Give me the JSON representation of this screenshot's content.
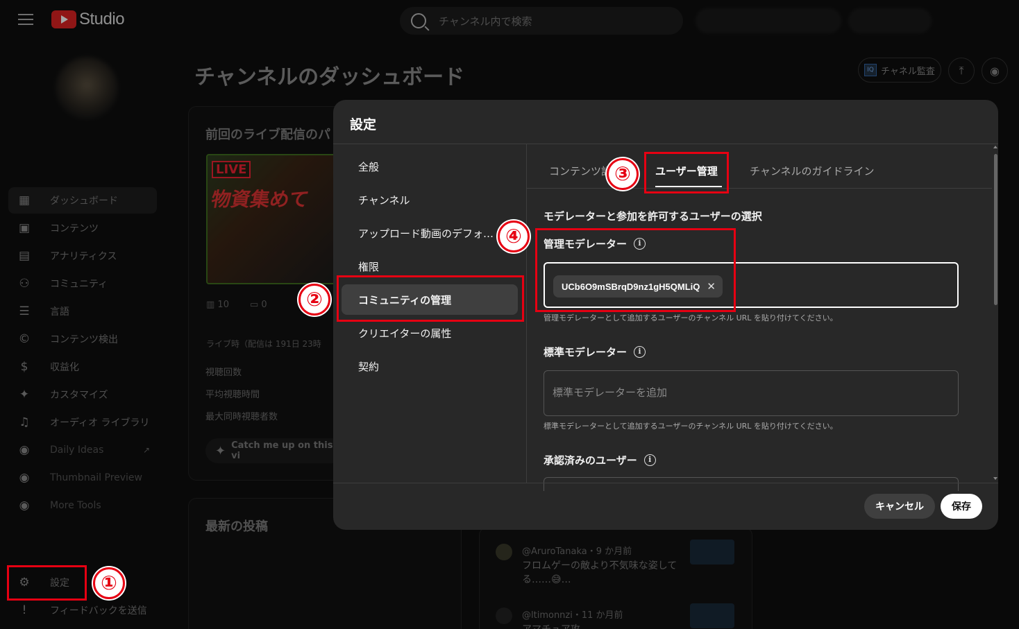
{
  "topbar": {
    "logo_text": "Studio",
    "search_placeholder": "チャンネル内で検索"
  },
  "sidebar": {
    "items": [
      {
        "label": "ダッシュボード",
        "icon": "dashboard-icon"
      },
      {
        "label": "コンテンツ",
        "icon": "content-icon"
      },
      {
        "label": "アナリティクス",
        "icon": "analytics-icon"
      },
      {
        "label": "コミュニティ",
        "icon": "community-icon"
      },
      {
        "label": "言語",
        "icon": "subtitles-icon"
      },
      {
        "label": "コンテンツ検出",
        "icon": "copyright-icon"
      },
      {
        "label": "収益化",
        "icon": "monetization-icon"
      },
      {
        "label": "カスタマイズ",
        "icon": "customize-icon"
      },
      {
        "label": "オーディオ ライブラリ",
        "icon": "audio-library-icon"
      },
      {
        "label": "Daily Ideas",
        "icon": "extension-icon"
      },
      {
        "label": "Thumbnail Preview",
        "icon": "extension-icon"
      },
      {
        "label": "More Tools",
        "icon": "extension-icon"
      }
    ],
    "settings_label": "設定",
    "feedback_label": "フィードバックを送信"
  },
  "main": {
    "title": "チャンネルのダッシュボード",
    "channel_audit_label": "チャネル監査",
    "live_card": {
      "title": "前回のライブ配信のパ",
      "thumb_live": "LIVE",
      "thumb_text": "物資集めて",
      "views": "10",
      "comments": "0",
      "summary": "ライブ時（配信は 191日 23時",
      "metrics": [
        "視聴回数",
        "平均視聴時間",
        "最大同時視聴者数"
      ],
      "catch_up": "Catch me up on this vi"
    },
    "posts_card_title": "最新の投稿",
    "comments": [
      {
        "name": "@AruroTanaka",
        "time": "・9 か月前",
        "text": "フロムゲーの敵より不気味な姿して る……😅…"
      },
      {
        "name": "@ltimonnzi",
        "time": "・11 か月前",
        "text": "アマチュア攻"
      }
    ]
  },
  "dialog": {
    "title": "設定",
    "nav": [
      "全般",
      "チャンネル",
      "アップロード動画のデフォルト設定",
      "権限",
      "コミュニティの管理",
      "クリエイターの属性",
      "契約"
    ],
    "active_nav_index": 4,
    "tabs": [
      "コンテンツ設定",
      "ユーザー管理",
      "チャンネルのガイドライン"
    ],
    "active_tab_index": 1,
    "section_heading": "モデレーターと参加を許可するユーザーの選択",
    "managing_moderators": {
      "label": "管理モデレーター",
      "chip": "UCb6O9mSBrqD9nz1gH5QMLiQ",
      "helper": "管理モデレーターとして追加するユーザーのチャンネル URL を貼り付けてください。"
    },
    "standard_moderators": {
      "label": "標準モデレーター",
      "placeholder": "標準モデレーターを追加",
      "helper": "標準モデレーターとして追加するユーザーのチャンネル URL を貼り付けてください。"
    },
    "approved_users": {
      "label": "承認済みのユーザー"
    },
    "cancel_label": "キャンセル",
    "save_label": "保存"
  },
  "annotations": {
    "colors": {
      "accent": "#e60012"
    },
    "steps": [
      "①",
      "②",
      "③",
      "④"
    ]
  }
}
